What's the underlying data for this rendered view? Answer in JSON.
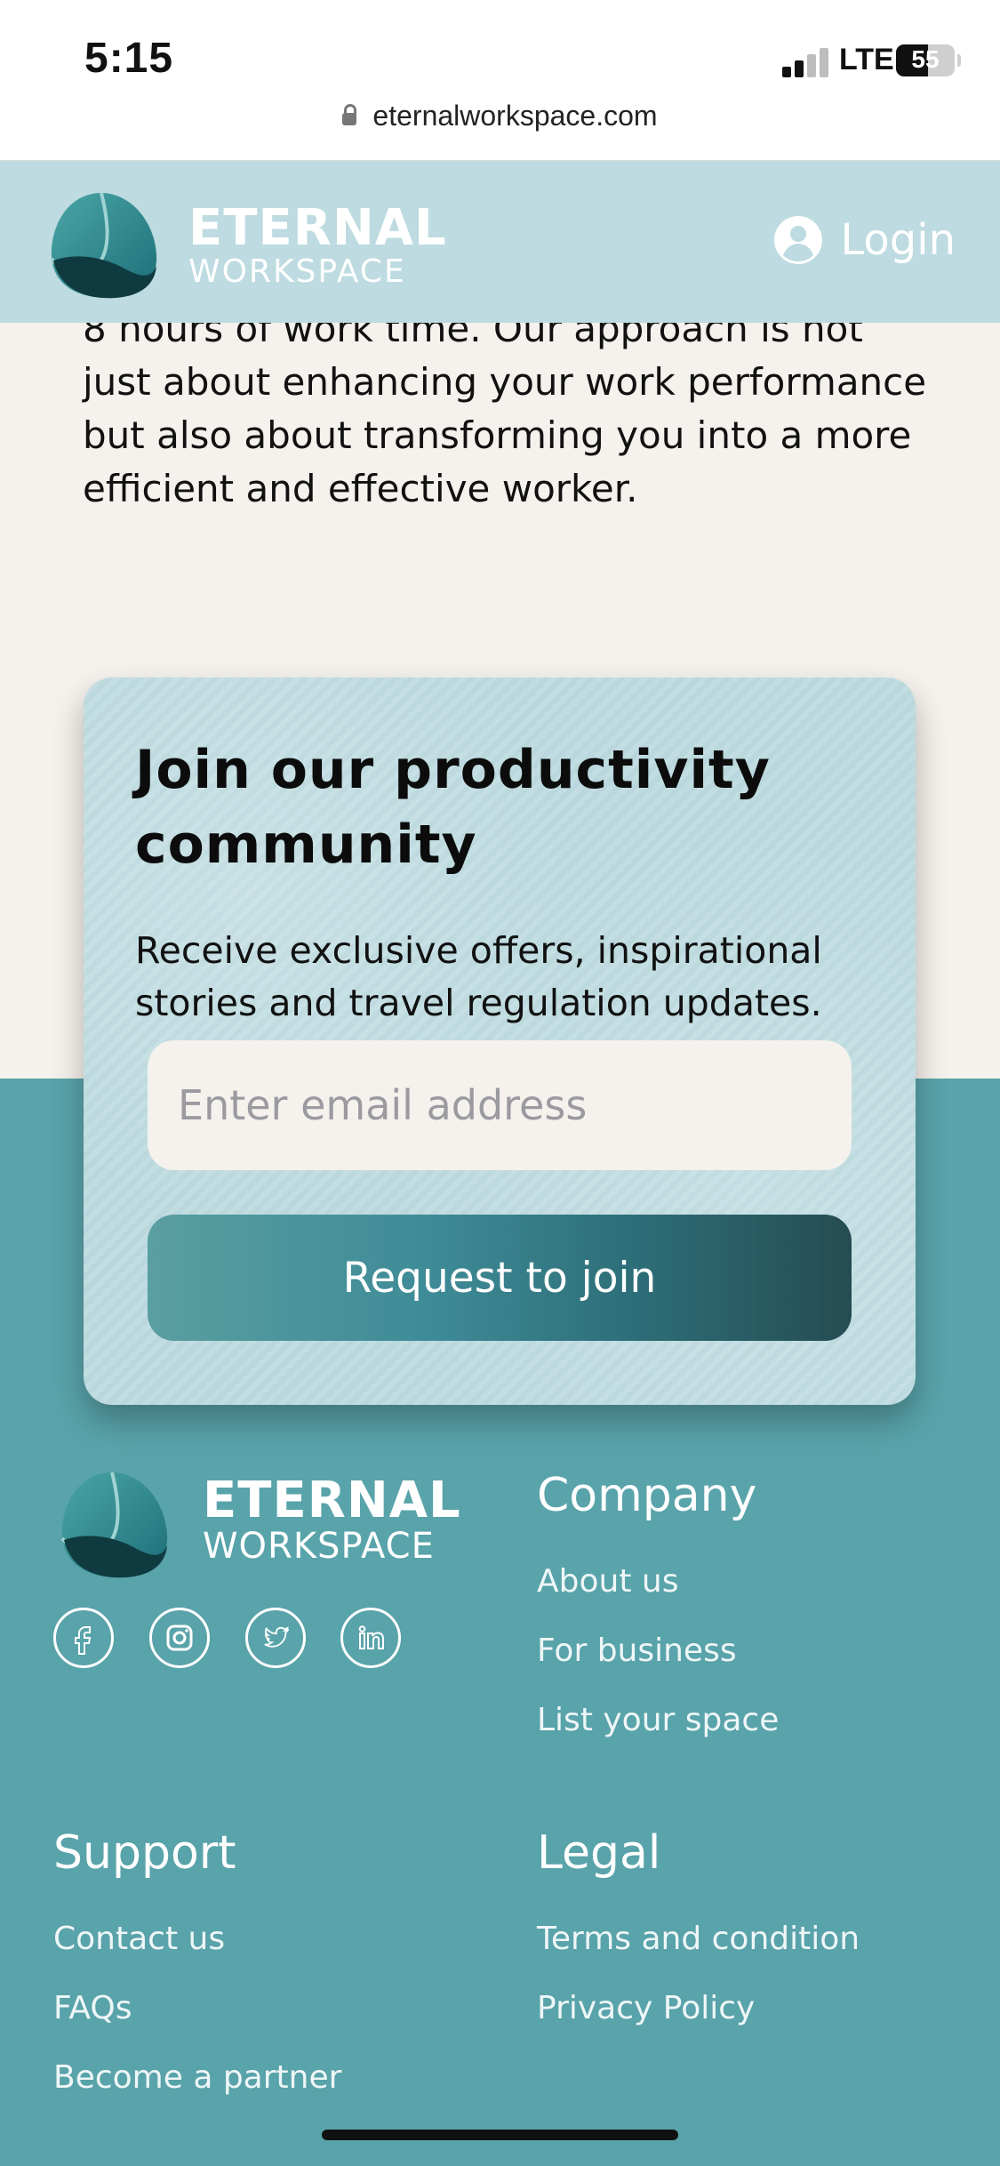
{
  "status_bar": {
    "time": "5:15",
    "network": "LTE",
    "battery": "55",
    "url": "eternalworkspace.com"
  },
  "header": {
    "brand_name": "ETERNAL",
    "brand_sub": "WORKSPACE",
    "login_label": "Login"
  },
  "intro": {
    "text": "8 hours of work time. Our approach is not just about enhancing your work performance but also about transforming you into a more efficient and effective worker."
  },
  "signup": {
    "title": "Join our productivity community",
    "description": "Receive exclusive offers, inspirational stories and travel regulation updates.",
    "email_placeholder": "Enter email address",
    "button_label": "Request to join"
  },
  "footer": {
    "brand_name": "ETERNAL",
    "brand_sub": "WORKSPACE",
    "social": [
      "facebook-icon",
      "instagram-icon",
      "twitter-icon",
      "linkedin-icon"
    ],
    "company": {
      "title": "Company",
      "links": [
        "About us",
        "For business",
        "List your space"
      ]
    },
    "support": {
      "title": "Support",
      "links": [
        "Contact us",
        "FAQs",
        "Become a partner"
      ]
    },
    "legal": {
      "title": "Legal",
      "links": [
        "Terms and condition",
        "Privacy Policy"
      ]
    }
  },
  "colors": {
    "header_bg": "#bddbe0",
    "page_bg": "#f5f1ec",
    "footer_bg": "#59a3aa",
    "button_gradient_start": "#5a9ea1",
    "button_gradient_end": "#254c52"
  }
}
